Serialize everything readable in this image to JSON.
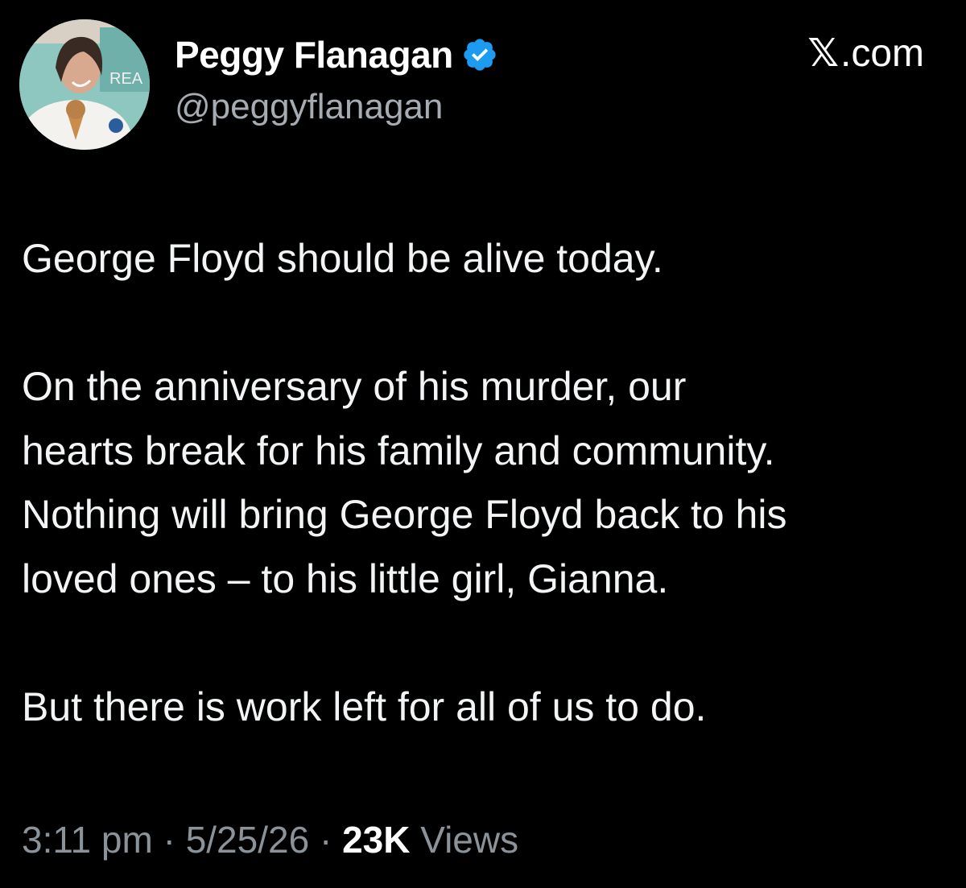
{
  "author": {
    "display_name": "Peggy Flanagan",
    "handle": "@peggyflanagan",
    "avatar_text": "REA",
    "verified_color": "#1d9bf0"
  },
  "source": {
    "label": ".com",
    "logo_glyph": "𝕏"
  },
  "tweet": {
    "paragraphs": [
      "George Floyd should be alive today.",
      "On the anniversary of his murder, our\nhearts break for his family and community.\nNothing will bring George Floyd back to his\nloved ones – to his little girl, Gianna.",
      "But there is work left for all of us to do."
    ]
  },
  "meta": {
    "time": "3:11 pm",
    "separator": "·",
    "date": "5/25/26",
    "views_count": "23K",
    "views_label": "Views"
  },
  "colors": {
    "background": "#000000",
    "text": "#e7e9ea",
    "secondary": "#8b939a"
  }
}
